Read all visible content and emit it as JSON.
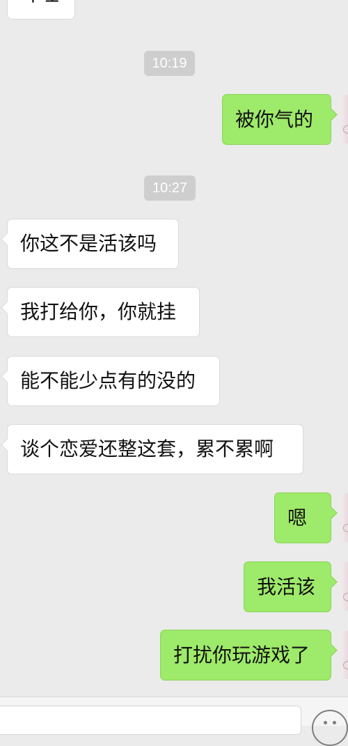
{
  "chat": {
    "top_partial_text": "叶哇",
    "timestamps": [
      "10:19",
      "10:27"
    ],
    "messages": [
      {
        "from": "me",
        "text": "被你气的"
      },
      {
        "from": "other",
        "text": "你这不是活该吗"
      },
      {
        "from": "other",
        "text": "我打给你，你就挂"
      },
      {
        "from": "other",
        "text": "能不能少点有的没的"
      },
      {
        "from": "other",
        "text": "谈个恋爱还整这套，累不累啊"
      },
      {
        "from": "me",
        "text": "嗯"
      },
      {
        "from": "me",
        "text": "我活该"
      },
      {
        "from": "me",
        "text": "打扰你玩游戏了"
      }
    ]
  },
  "input_bar": {
    "input_value": "",
    "emoji_icon": "emoji-face-icon"
  },
  "colors": {
    "background": "#ebebeb",
    "incoming_bubble": "#ffffff",
    "outgoing_bubble": "#9eea6a",
    "timestamp_bg": "#cecece",
    "timestamp_text": "#ffffff"
  }
}
